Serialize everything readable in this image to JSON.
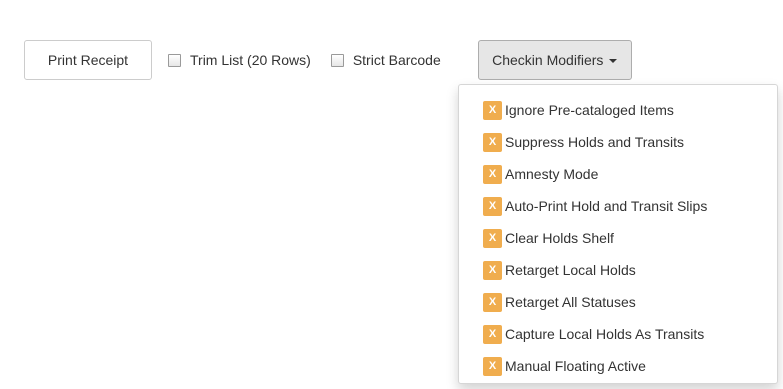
{
  "toolbar": {
    "print_receipt_label": "Print Receipt",
    "trim_list_label": "Trim List (20 Rows)",
    "trim_list_checked": false,
    "strict_barcode_label": "Strict Barcode",
    "strict_barcode_checked": false,
    "checkin_modifiers_label": "Checkin Modifiers"
  },
  "menu": {
    "badge_glyph": "X",
    "badge_color": "#f0ad4e",
    "items": [
      {
        "label": "Ignore Pre-cataloged Items",
        "enabled": true
      },
      {
        "label": "Suppress Holds and Transits",
        "enabled": true
      },
      {
        "label": "Amnesty Mode",
        "enabled": true
      },
      {
        "label": "Auto-Print Hold and Transit Slips",
        "enabled": true
      },
      {
        "label": "Clear Holds Shelf",
        "enabled": true
      },
      {
        "label": "Retarget Local Holds",
        "enabled": true
      },
      {
        "label": "Retarget All Statuses",
        "enabled": true
      },
      {
        "label": "Capture Local Holds As Transits",
        "enabled": true
      },
      {
        "label": "Manual Floating Active",
        "enabled": true
      }
    ]
  }
}
